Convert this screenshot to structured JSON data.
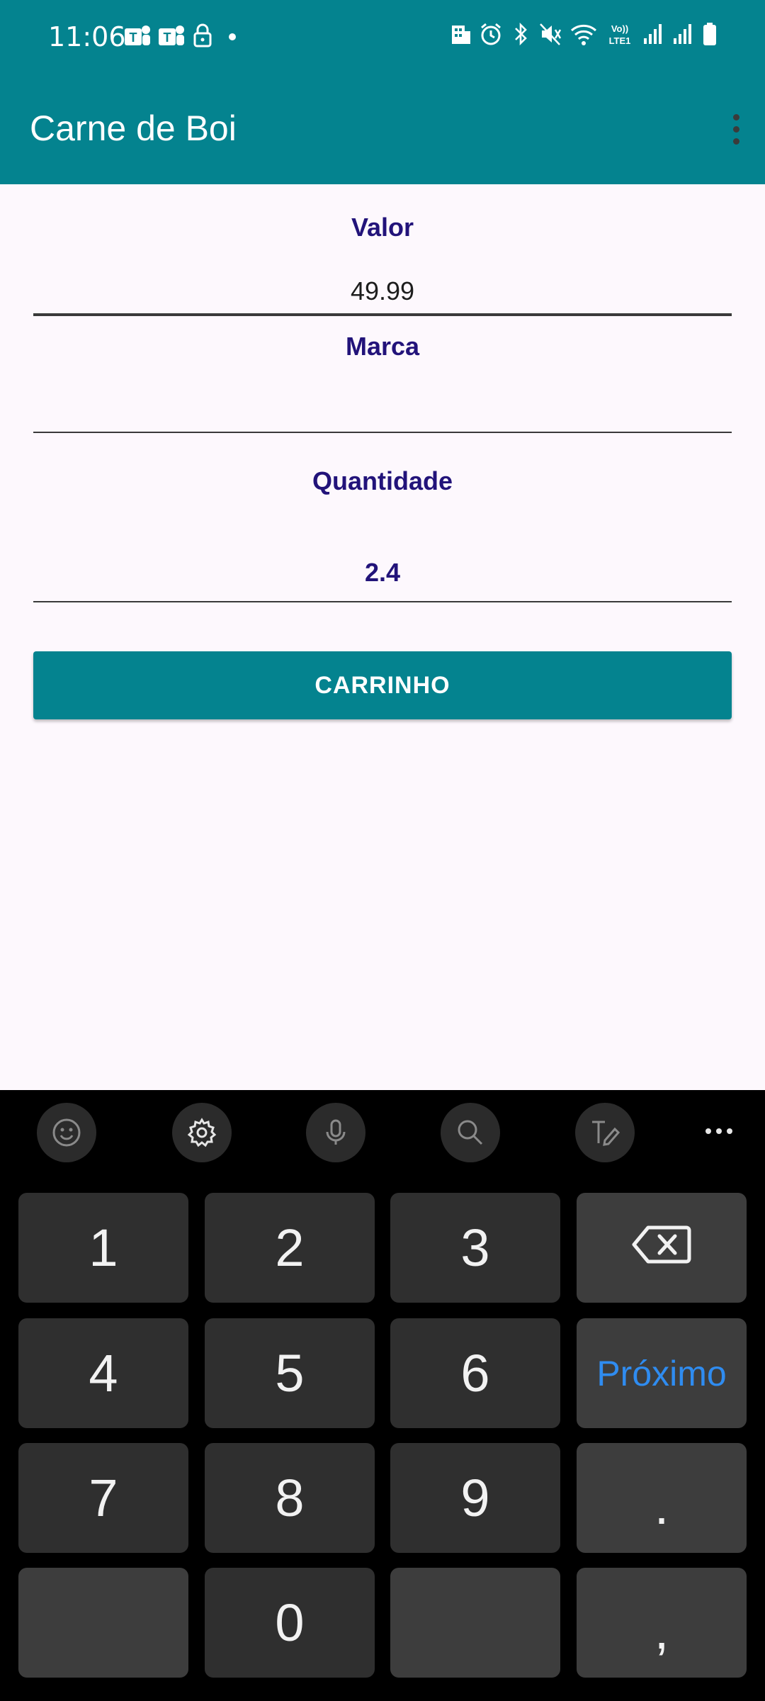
{
  "status_bar": {
    "time": "11:06",
    "left_icons": [
      "teams-icon",
      "teams-icon",
      "lock-icon",
      "dot-icon"
    ],
    "right_icons": [
      "building-icon",
      "alarm-icon",
      "bluetooth-icon",
      "mute-icon",
      "wifi-icon",
      "volte-icon",
      "signal-icon",
      "signal-icon",
      "battery-icon"
    ],
    "volte_label": "Vo)) LTE1"
  },
  "app_bar": {
    "title": "Carne de Boi"
  },
  "form": {
    "valor_label": "Valor",
    "valor_value": "49.99",
    "marca_label": "Marca",
    "marca_value": "",
    "quantidade_label": "Quantidade",
    "quantidade_value": "2.4",
    "cart_button": "CARRINHO"
  },
  "keyboard": {
    "toolbar": [
      "emoji-icon",
      "settings-icon",
      "microphone-icon",
      "search-icon",
      "handwriting-icon",
      "more-icon"
    ],
    "keys": {
      "k1": "1",
      "k2": "2",
      "k3": "3",
      "k4": "4",
      "k5": "5",
      "k6": "6",
      "k7": "7",
      "k8": "8",
      "k9": "9",
      "k0": "0",
      "next": "Próximo",
      "dot": ".",
      "comma": ","
    }
  },
  "colors": {
    "primary": "#04838f",
    "label": "#22137a",
    "background": "#fdf8fd",
    "keyboard_bg": "#000000",
    "key_bg": "#2f2f2f",
    "next_key_text": "#2f8cf0"
  }
}
